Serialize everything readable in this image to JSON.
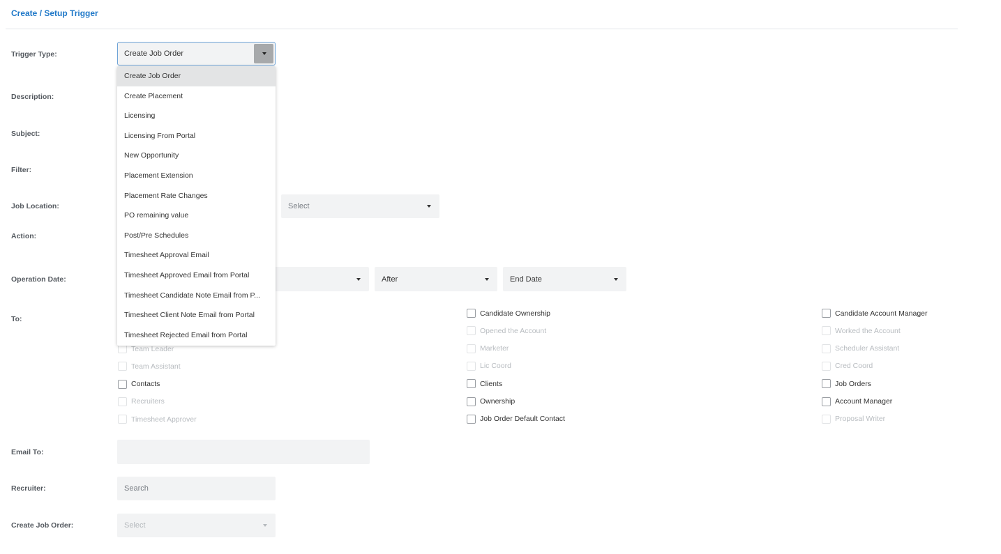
{
  "page": {
    "title": "Create / Setup Trigger"
  },
  "labels": {
    "trigger_type": "Trigger Type:",
    "description": "Description:",
    "subject": "Subject:",
    "filter": "Filter:",
    "job_location": "Job Location:",
    "action": "Action:",
    "operation_date": "Operation Date:",
    "to": "To:",
    "email_to": "Email To:",
    "recruiter": "Recruiter:",
    "create_job_order": "Create Job Order:"
  },
  "trigger_type": {
    "value": "Create Job Order",
    "options": [
      "Create Job Order",
      "Create Placement",
      "Licensing",
      "Licensing From Portal",
      "New Opportunity",
      "Placement Extension",
      "Placement Rate Changes",
      "PO remaining value",
      "Post/Pre Schedules",
      "Timesheet Approval Email",
      "Timesheet Approved Email from Portal",
      "Timesheet Candidate Note Email from P...",
      "Timesheet Client Note Email from Portal",
      "Timesheet Rejected Email from Portal"
    ]
  },
  "job_location": {
    "placeholder": "Select"
  },
  "operation_date": {
    "relation": "After",
    "date_field": "End Date"
  },
  "to": {
    "col1": [
      {
        "label": "Team Leader",
        "enabled": false
      },
      {
        "label": "Team Assistant",
        "enabled": false
      },
      {
        "label": "Contacts",
        "enabled": true
      },
      {
        "label": "Recruiters",
        "enabled": false
      },
      {
        "label": "Timesheet Approver",
        "enabled": false
      }
    ],
    "col2": [
      {
        "label": "Candidate Ownership",
        "enabled": true
      },
      {
        "label": "Opened the Account",
        "enabled": false
      },
      {
        "label": "Marketer",
        "enabled": false
      },
      {
        "label": "Lic Coord",
        "enabled": false
      },
      {
        "label": "Clients",
        "enabled": true
      },
      {
        "label": "Ownership",
        "enabled": true
      },
      {
        "label": "Job Order Default Contact",
        "enabled": true
      }
    ],
    "col3": [
      {
        "label": "Candidate Account Manager",
        "enabled": true
      },
      {
        "label": "Worked the Account",
        "enabled": false
      },
      {
        "label": "Scheduler Assistant",
        "enabled": false
      },
      {
        "label": "Cred Coord",
        "enabled": false
      },
      {
        "label": "Job Orders",
        "enabled": true
      },
      {
        "label": "Account Manager",
        "enabled": true
      },
      {
        "label": "Proposal Writer",
        "enabled": false
      }
    ]
  },
  "email_to": {
    "value": ""
  },
  "recruiter": {
    "placeholder": "Search"
  },
  "create_job_order": {
    "placeholder": "Select"
  },
  "colors": {
    "accent": "#1f78c8",
    "field_bg": "#f2f3f4"
  }
}
